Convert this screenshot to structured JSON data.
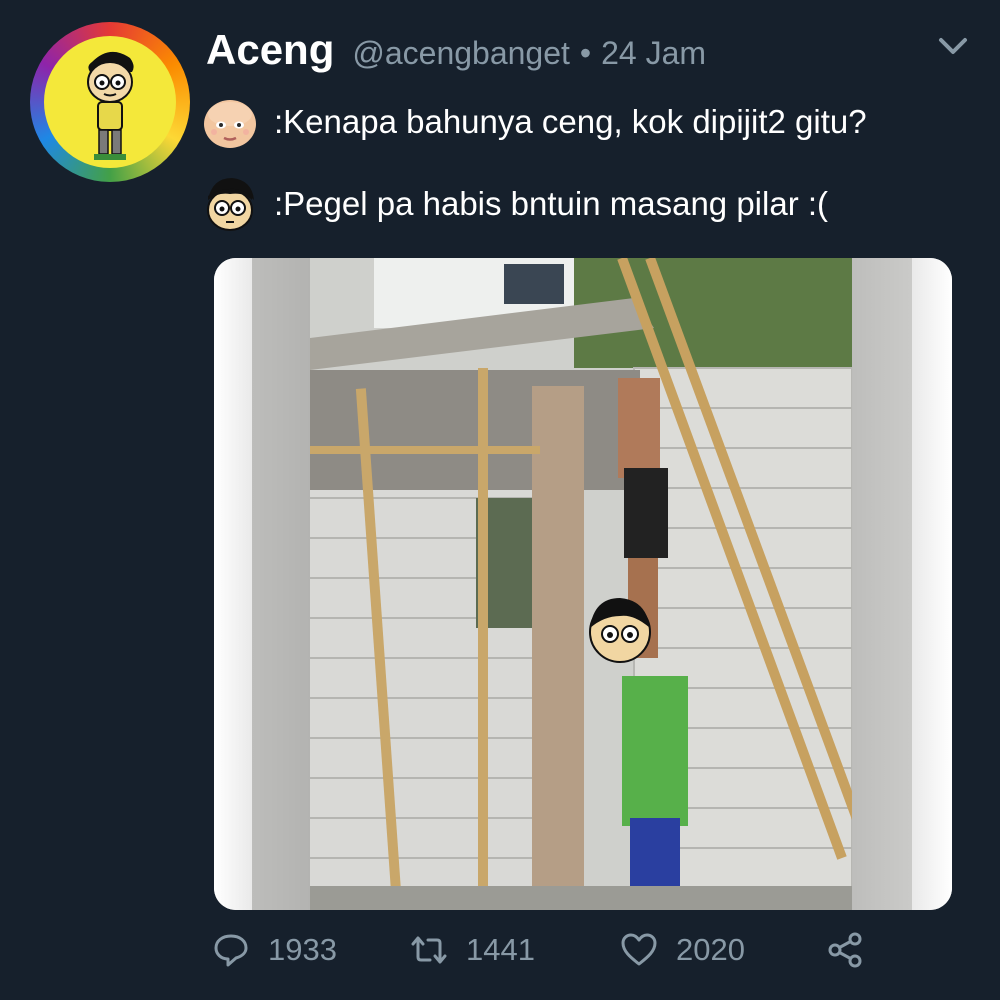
{
  "tweet": {
    "display_name": "Aceng",
    "handle": "@acengbanget",
    "separator": "•",
    "timestamp": "24 Jam",
    "dialog": [
      {
        "speaker_icon": "baby-face-icon",
        "text": ":Kenapa bahunya ceng, kok dipijit2 gitu?"
      },
      {
        "speaker_icon": "cartoon-boy-face-icon",
        "text": ":Pegel pa habis bntuin masang pilar :("
      }
    ]
  },
  "stats": {
    "replies": "1933",
    "retweets": "1441",
    "likes": "2020"
  },
  "icons": {
    "menu": "chevron-down-icon",
    "reply": "reply-icon",
    "retweet": "retweet-icon",
    "like": "heart-icon",
    "share": "share-icon"
  },
  "colors": {
    "background": "#16202c",
    "muted_text": "#8899a6",
    "primary_text": "#ffffff"
  }
}
